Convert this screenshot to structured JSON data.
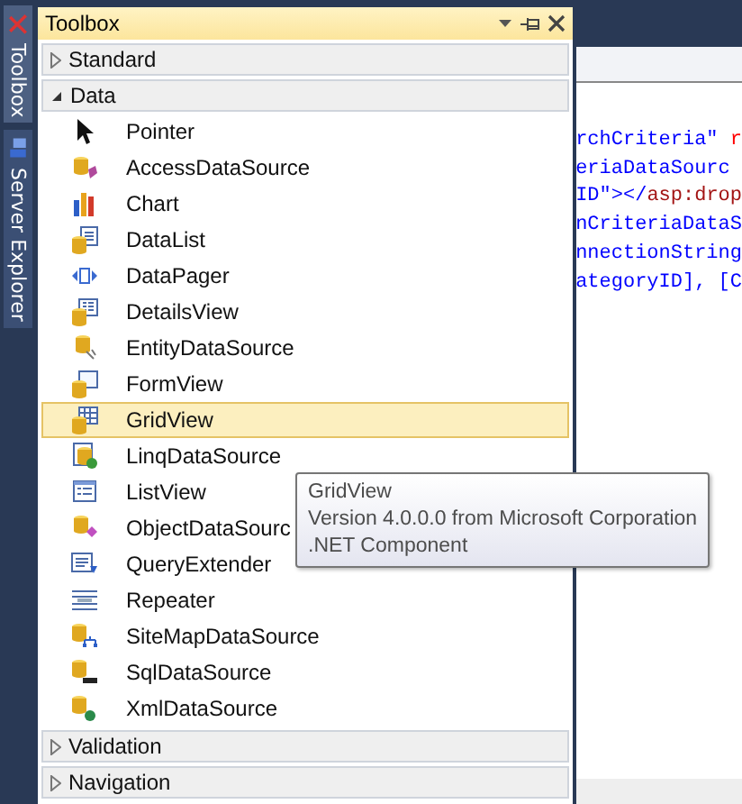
{
  "side_tabs": [
    {
      "label": "Toolbox",
      "selected": true
    },
    {
      "label": "Server Explorer",
      "selected": false
    }
  ],
  "toolbox": {
    "title": "Toolbox",
    "groups": [
      {
        "label": "Standard",
        "expanded": false
      },
      {
        "label": "Data",
        "expanded": true,
        "items": [
          {
            "label": "Pointer",
            "selected": false
          },
          {
            "label": "AccessDataSource",
            "selected": false
          },
          {
            "label": "Chart",
            "selected": false
          },
          {
            "label": "DataList",
            "selected": false
          },
          {
            "label": "DataPager",
            "selected": false
          },
          {
            "label": "DetailsView",
            "selected": false
          },
          {
            "label": "EntityDataSource",
            "selected": false
          },
          {
            "label": "FormView",
            "selected": false
          },
          {
            "label": "GridView",
            "selected": true
          },
          {
            "label": "LinqDataSource",
            "selected": false
          },
          {
            "label": "ListView",
            "selected": false
          },
          {
            "label": "ObjectDataSourc",
            "selected": false
          },
          {
            "label": "QueryExtender",
            "selected": false
          },
          {
            "label": "Repeater",
            "selected": false
          },
          {
            "label": "SiteMapDataSource",
            "selected": false
          },
          {
            "label": "SqlDataSource",
            "selected": false
          },
          {
            "label": "XmlDataSource",
            "selected": false
          }
        ]
      },
      {
        "label": "Validation",
        "expanded": false
      },
      {
        "label": "Navigation",
        "expanded": false
      }
    ]
  },
  "editor": {
    "code_lines": [
      [
        {
          "text": "rchCriteria\"",
          "kind": "value"
        },
        {
          "text": " r",
          "kind": "attribute"
        }
      ],
      [
        {
          "text": "eriaDataSourc",
          "kind": "value"
        }
      ],
      [
        {
          "text": "ID\"",
          "kind": "value"
        },
        {
          "text": "></",
          "kind": "value"
        },
        {
          "text": "asp:drop",
          "kind": "tag"
        }
      ],
      [
        {
          "text": "nCriteriaDataS",
          "kind": "value"
        }
      ],
      [
        {
          "text": "nnectionString",
          "kind": "value"
        }
      ],
      [
        {
          "text": "ategoryID], [C",
          "kind": "value"
        }
      ]
    ]
  },
  "tooltip": {
    "title": "GridView",
    "lines": [
      "Version 4.0.0.0 from Microsoft Corporation",
      ".NET Component"
    ]
  }
}
